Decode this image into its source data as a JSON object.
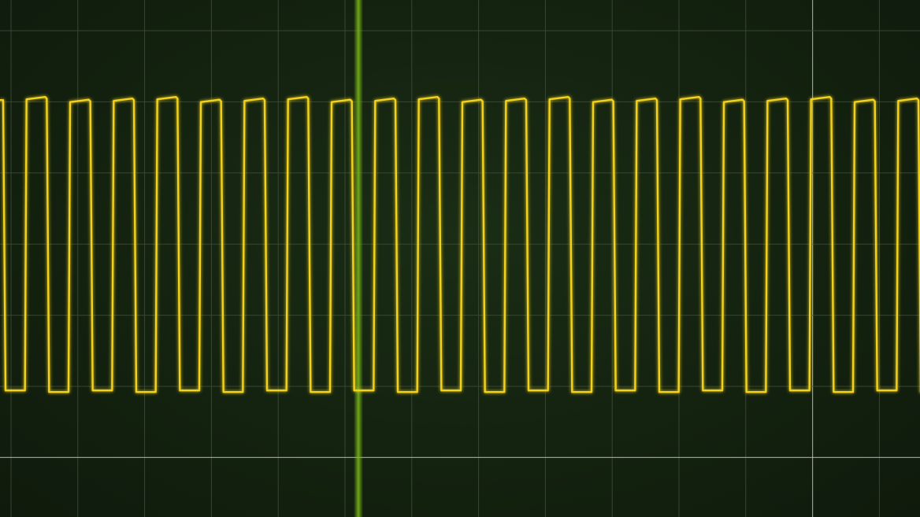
{
  "chart_data": {
    "type": "line",
    "title": "",
    "xlabel": "",
    "ylabel": "",
    "grid": true,
    "grid_divisions": {
      "x": 14,
      "y": 7
    },
    "trigger_marker": true,
    "signal": {
      "shape": "square",
      "cycles": 21,
      "duty_cycle": 0.5,
      "high_level_div": 2.0,
      "low_level_div": -2.0,
      "x_range_div": [
        0,
        14
      ],
      "y_range_div": [
        -3.5,
        3.5
      ]
    }
  },
  "colors": {
    "background": "#13200f",
    "grid": "#3c4a36",
    "grid_bright": "#b8bcb2",
    "trace": "#f2d21c",
    "trigger_marker": "#7fbf1a"
  }
}
